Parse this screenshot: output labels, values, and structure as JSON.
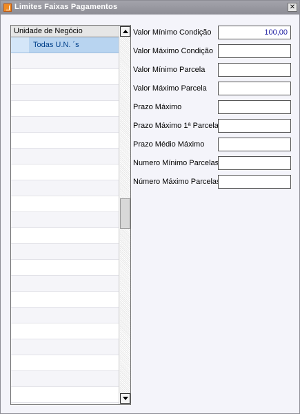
{
  "window": {
    "title": "Limites Faixas Pagamentos",
    "close_glyph": "✕"
  },
  "grid": {
    "header": "Unidade de Negócio",
    "rows": [
      "Todas U.N. ´s"
    ]
  },
  "fields": [
    {
      "label": "Valor Mínimo Condição",
      "value": "100,00"
    },
    {
      "label": "Valor Máximo Condição",
      "value": ""
    },
    {
      "label": "Valor Mínimo Parcela",
      "value": ""
    },
    {
      "label": "Valor Máximo Parcela",
      "value": ""
    },
    {
      "label": "Prazo Máximo",
      "value": ""
    },
    {
      "label": "Prazo Máximo 1ª Parcela",
      "value": ""
    },
    {
      "label": "Prazo Médio Máximo",
      "value": ""
    },
    {
      "label": "Numero Mínimo Parcelas",
      "value": ""
    },
    {
      "label": "Número Máximo Parcelas",
      "value": ""
    }
  ],
  "colors": {
    "titlebar": "#8d8d95",
    "selected_row": "#b8d4f0",
    "value_text": "#1a1aa0"
  }
}
